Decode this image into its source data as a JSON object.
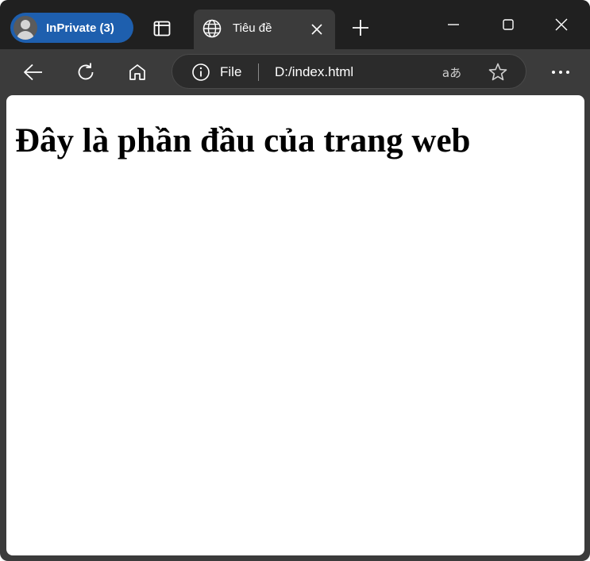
{
  "profile": {
    "label": "InPrivate (3)",
    "icon": "avatar-icon"
  },
  "tabs": [
    {
      "title": "Tiêu đề",
      "icon": "globe-icon",
      "active": true
    }
  ],
  "address_bar": {
    "scheme_label": "File",
    "url": "D:/index.html",
    "translate_glyph": "aあ"
  },
  "page": {
    "heading": "Đây là phần đầu của trang web"
  },
  "colors": {
    "titlebar": "#202020",
    "toolbar": "#3b3b3b",
    "profile_badge": "#1e5fae",
    "page_background": "#ffffff"
  }
}
